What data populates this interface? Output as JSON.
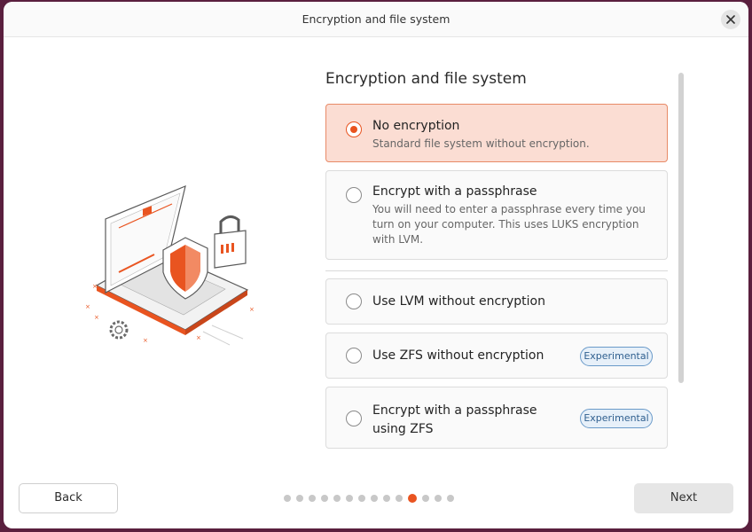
{
  "window": {
    "title": "Encryption and file system"
  },
  "main": {
    "heading": "Encryption and file system",
    "options": [
      {
        "title": "No encryption",
        "description": "Standard file system without encryption.",
        "selected": true
      },
      {
        "title": "Encrypt with a passphrase",
        "description": "You will need to enter a passphrase every time you turn on your computer. This uses LUKS encryption with LVM.",
        "selected": false
      },
      {
        "title": "Use LVM without encryption",
        "selected": false
      },
      {
        "title": "Use ZFS without encryption",
        "badge": "Experimental",
        "selected": false
      },
      {
        "title": "Encrypt with a passphrase using ZFS",
        "badge": "Experimental",
        "selected": false
      }
    ]
  },
  "footer": {
    "back_label": "Back",
    "next_label": "Next",
    "progress": {
      "total_steps": 14,
      "current_step": 11
    }
  },
  "colors": {
    "accent": "#e95420",
    "selected_bg": "#fbddd3",
    "badge_border": "#6a9ac9"
  },
  "icons": [
    "close-icon",
    "laptop-illustration",
    "shield-icon",
    "padlock-icon",
    "gear-icon"
  ]
}
